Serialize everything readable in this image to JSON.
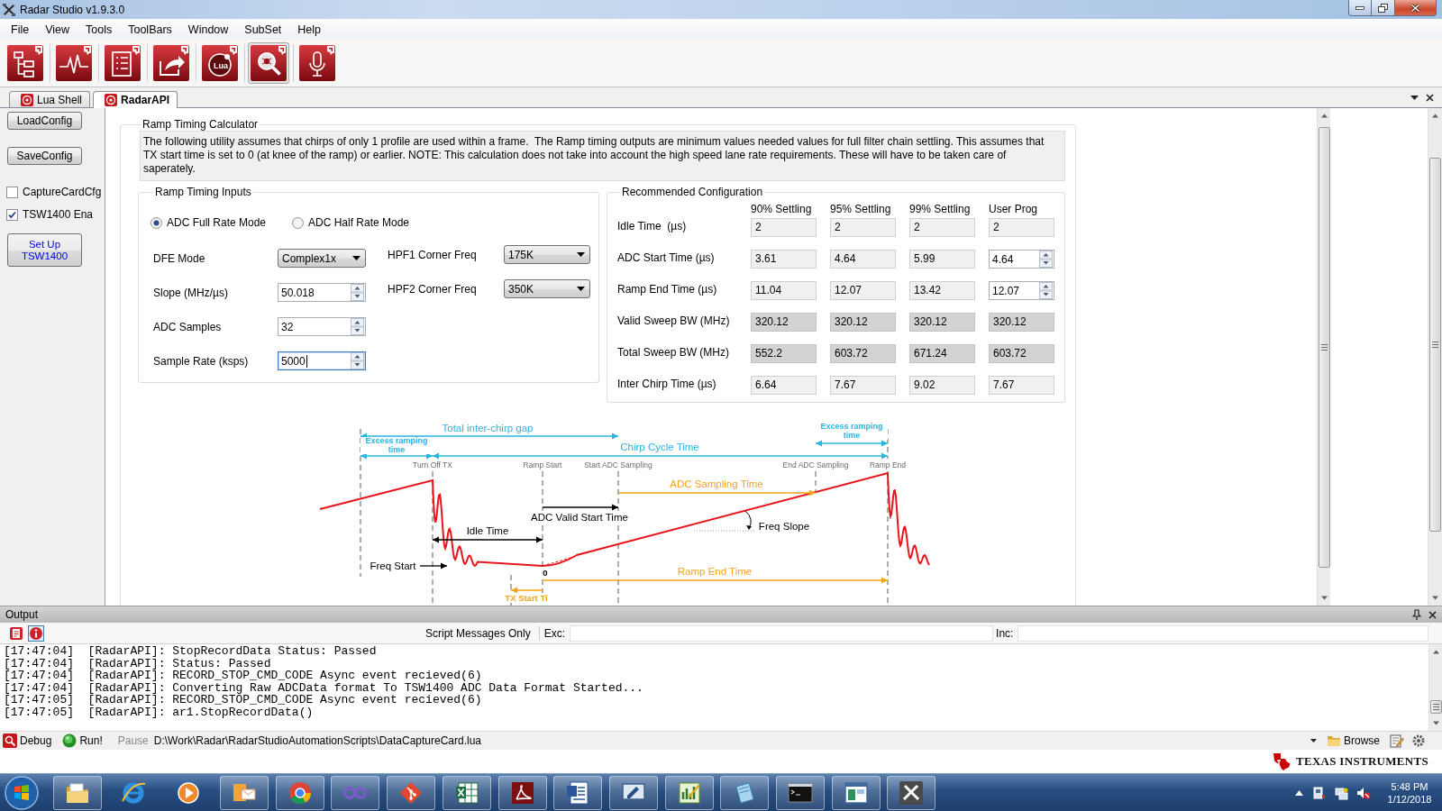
{
  "window": {
    "title": "Radar Studio v1.9.3.0"
  },
  "menu": [
    "File",
    "View",
    "Tools",
    "ToolBars",
    "Window",
    "SubSet",
    "Help"
  ],
  "toolbar": [
    {
      "checked": false
    },
    {
      "checked": false
    },
    {
      "checked": false
    },
    {
      "checked": false
    },
    {
      "checked": false,
      "icon_text": "Lua"
    },
    {
      "checked": true
    },
    {
      "checked": false
    }
  ],
  "tabs": [
    {
      "label": "Lua Shell",
      "selected": false
    },
    {
      "label": "RadarAPI",
      "selected": true
    }
  ],
  "sidebar": {
    "buttons": [
      {
        "label": "LoadConfig"
      },
      {
        "label": "SaveConfig"
      }
    ],
    "checkboxes": [
      {
        "label": "CaptureCardCfg",
        "checked": false
      },
      {
        "label": "TSW1400 Ena",
        "checked": true
      }
    ],
    "setup_button": {
      "label": "Set Up TSW1400"
    }
  },
  "calculator": {
    "title": "Ramp Timing Calculator",
    "description": "The following utility assumes that chirps of only 1 profile are used within a frame.  The Ramp timing outputs are minimum values needed values for full filter chain settling. This assumes that TX start time is set to 0 (at knee of the ramp) or earlier. NOTE: This calculation does not take into account the high speed lane rate requirements. These will have to be taken care of saperately.",
    "inputs": {
      "title": "Ramp Timing Inputs",
      "modes": [
        {
          "label": "ADC Full Rate Mode",
          "selected": true
        },
        {
          "label": "ADC Half Rate Mode",
          "selected": false
        }
      ],
      "left_fields": [
        {
          "label": "DFE Mode",
          "kind": "dropdown",
          "value": "Complex1x",
          "focused": false
        },
        {
          "label": "Slope (MHz/µs)",
          "kind": "spin",
          "value": "50.018",
          "focused": false
        },
        {
          "label": "ADC Samples",
          "kind": "spin",
          "value": "32",
          "focused": false
        },
        {
          "label": "Sample Rate (ksps)",
          "kind": "spin",
          "value": "5000",
          "focused": true
        }
      ],
      "right_fields": [
        {
          "label": "HPF1 Corner Freq",
          "kind": "dropdown",
          "value": "175K",
          "focused": false
        },
        {
          "label": "HPF2 Corner Freq",
          "kind": "dropdown",
          "value": "350K",
          "focused": false
        }
      ]
    },
    "recommended": {
      "title": "Recommended Configuration",
      "columns": [
        "90% Settling",
        "95% Settling",
        "99% Settling",
        "User Prog"
      ],
      "rows": [
        {
          "label": "Idle Time  (µs)",
          "cells": [
            {
              "kind": "readonly",
              "value": "2"
            },
            {
              "kind": "readonly",
              "value": "2"
            },
            {
              "kind": "readonly",
              "value": "2"
            },
            {
              "kind": "readonly",
              "value": "2"
            }
          ]
        },
        {
          "label": "ADC Start Time (µs)",
          "cells": [
            {
              "kind": "readonly",
              "value": "3.61"
            },
            {
              "kind": "readonly",
              "value": "4.64"
            },
            {
              "kind": "readonly",
              "value": "5.99"
            },
            {
              "kind": "spin",
              "value": "4.64"
            }
          ]
        },
        {
          "label": "Ramp End Time (µs)",
          "cells": [
            {
              "kind": "readonly",
              "value": "11.04"
            },
            {
              "kind": "readonly",
              "value": "12.07"
            },
            {
              "kind": "readonly",
              "value": "13.42"
            },
            {
              "kind": "spin",
              "value": "12.07"
            }
          ]
        },
        {
          "label": "Valid Sweep BW (MHz)",
          "cells": [
            {
              "kind": "shaded",
              "value": "320.12"
            },
            {
              "kind": "shaded",
              "value": "320.12"
            },
            {
              "kind": "shaded",
              "value": "320.12"
            },
            {
              "kind": "shaded",
              "value": "320.12"
            }
          ]
        },
        {
          "label": "Total Sweep BW (MHz)",
          "cells": [
            {
              "kind": "shaded",
              "value": "552.2"
            },
            {
              "kind": "shaded",
              "value": "603.72"
            },
            {
              "kind": "shaded",
              "value": "671.24"
            },
            {
              "kind": "shaded",
              "value": "603.72"
            }
          ]
        },
        {
          "label": "Inter Chirp Time (µs)",
          "cells": [
            {
              "kind": "readonly",
              "value": "6.64"
            },
            {
              "kind": "readonly",
              "value": "7.67"
            },
            {
              "kind": "readonly",
              "value": "9.02"
            },
            {
              "kind": "readonly",
              "value": "7.67"
            }
          ]
        }
      ]
    },
    "timing_diagram": {
      "spans": [
        {
          "text": "Total inter-chirp gap",
          "color": "#2ab4e0"
        },
        {
          "text": "Excess ramping time",
          "color": "#2ab4e0"
        },
        {
          "text": "Excess ramping time",
          "color": "#2ab4e0"
        },
        {
          "text": "Chirp Cycle Time",
          "color": "#2ab4e0"
        },
        {
          "text": "ADC Sampling Time",
          "color": "#f5a31a"
        },
        {
          "text": "ADC Valid Start Time",
          "color": "#000000"
        },
        {
          "text": "Idle Time",
          "color": "#000000"
        },
        {
          "text": "Ramp End Time",
          "color": "#f5a31a"
        },
        {
          "text": "TX Start Ti",
          "color": "#f5a31a"
        }
      ],
      "markers": [
        "Turn Off TX",
        "Ramp Start",
        "Start ADC Sampling",
        "End ADC Sampling",
        "Ramp End"
      ],
      "notes": [
        "Freq Slope",
        "Freq Start",
        "0"
      ]
    }
  },
  "output": {
    "title": "Output",
    "toolbar_buttons": [
      {
        "pressed": false
      },
      {
        "pressed": true
      }
    ],
    "filter_label": "Script Messages Only",
    "exclude_label": "Exc:",
    "include_label": "Inc:",
    "lines": [
      "[17:47:04]  [RadarAPI]: StopRecordData Status: Passed",
      "[17:47:04]  [RadarAPI]: Status: Passed",
      "[17:47:04]  [RadarAPI]: RECORD_STOP_CMD_CODE Async event recieved(6)",
      "[17:47:04]  [RadarAPI]: Converting Raw ADCData format To TSW1400 ADC Data Format Started...",
      "[17:47:05]  [RadarAPI]: RECORD_STOP_CMD_CODE Async event recieved(6)",
      "[17:47:05]  [RadarAPI]: ar1.StopRecordData()"
    ]
  },
  "script_bar": {
    "buttons": [
      {
        "label": "Debug",
        "disabled": false
      },
      {
        "label": "Run!",
        "disabled": false
      },
      {
        "label": "Pause",
        "disabled": true
      }
    ],
    "path": "D:\\Work\\Radar\\RadarStudioAutomationScripts\\DataCaptureCard.lua",
    "browse": "Browse"
  },
  "brand": "TEXAS INSTRUMENTS",
  "taskbar": {
    "apps": [
      {
        "running": true
      },
      {
        "running": false
      },
      {
        "running": false
      },
      {
        "running": true
      },
      {
        "running": true
      },
      {
        "running": true
      },
      {
        "running": true
      },
      {
        "running": true
      },
      {
        "running": true
      },
      {
        "running": true
      },
      {
        "running": true
      },
      {
        "running": true
      },
      {
        "running": true
      },
      {
        "running": true
      },
      {
        "running": true
      },
      {
        "running": true
      }
    ],
    "time": "5:48 PM",
    "date": "1/12/2018"
  }
}
